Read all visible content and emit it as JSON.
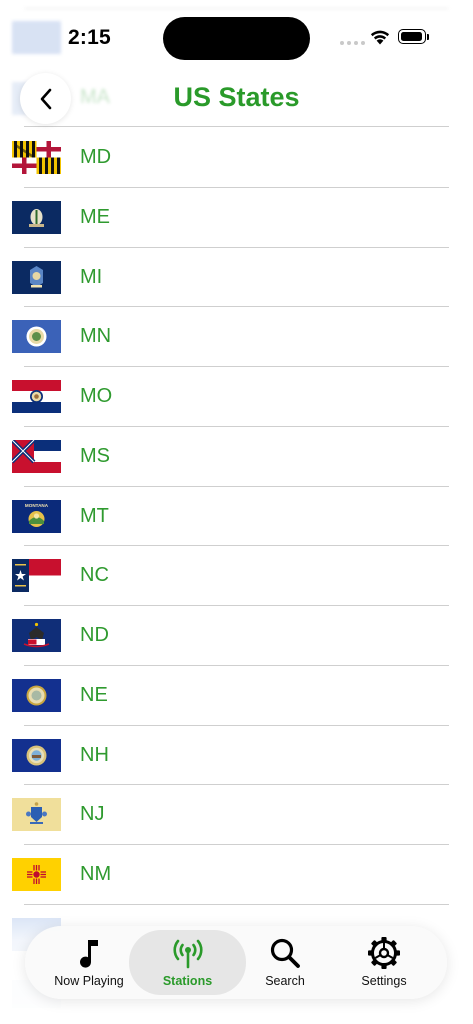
{
  "status_bar": {
    "time": "2:15"
  },
  "header": {
    "title": "US States",
    "back_icon": "chevron-left-icon",
    "ghost_label": "MA"
  },
  "accent_color": "#2a9a2a",
  "states": [
    {
      "code": "MD",
      "flag": "maryland-flag"
    },
    {
      "code": "ME",
      "flag": "maine-flag"
    },
    {
      "code": "MI",
      "flag": "michigan-flag"
    },
    {
      "code": "MN",
      "flag": "minnesota-flag"
    },
    {
      "code": "MO",
      "flag": "missouri-flag"
    },
    {
      "code": "MS",
      "flag": "mississippi-flag"
    },
    {
      "code": "MT",
      "flag": "montana-flag"
    },
    {
      "code": "NC",
      "flag": "north-carolina-flag"
    },
    {
      "code": "ND",
      "flag": "north-dakota-flag"
    },
    {
      "code": "NE",
      "flag": "nebraska-flag"
    },
    {
      "code": "NH",
      "flag": "new-hampshire-flag"
    },
    {
      "code": "NJ",
      "flag": "new-jersey-flag"
    },
    {
      "code": "NM",
      "flag": "new-mexico-flag"
    }
  ],
  "flag_texts": {
    "montana": "MONTANA"
  },
  "tab_bar": {
    "active": "Stations",
    "tabs": [
      {
        "label": "Now Playing",
        "icon": "music-note-icon"
      },
      {
        "label": "Stations",
        "icon": "antenna-icon"
      },
      {
        "label": "Search",
        "icon": "search-icon"
      },
      {
        "label": "Settings",
        "icon": "gear-icon"
      }
    ]
  }
}
